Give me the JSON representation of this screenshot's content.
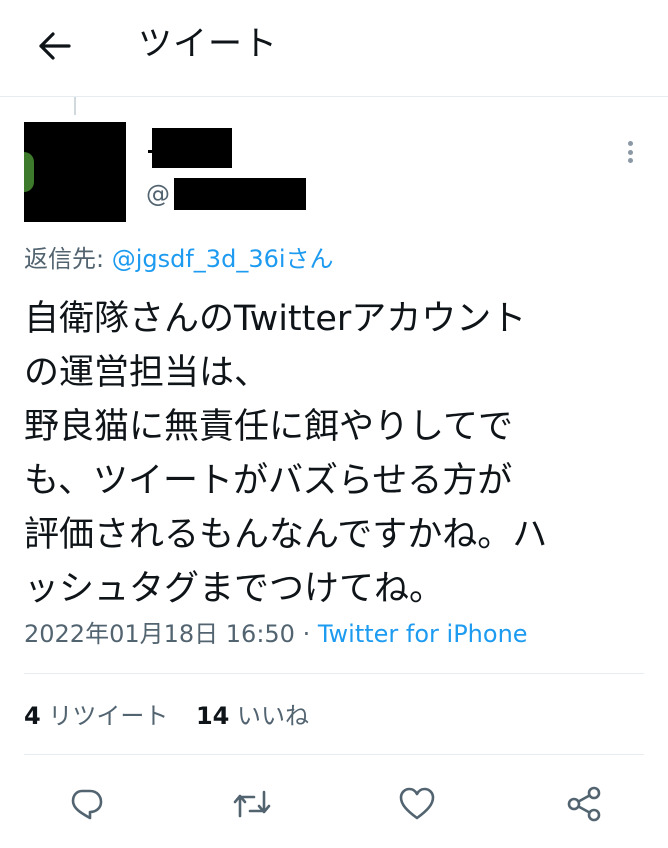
{
  "header": {
    "title": "ツイート"
  },
  "author": {
    "handle_prefix": "@"
  },
  "reply_to": {
    "prefix": "返信先: ",
    "handle": "@jgsdf_3d_36iさん"
  },
  "tweet": {
    "lines": [
      "自衛隊さんのTwitterアカウント",
      "の運営担当は、",
      "野良猫に無責任に餌やりしてで",
      "も、ツイートがバズらせる方が",
      "評価されるもんなんですかね。ハ",
      "ッシュタグまでつけてね。"
    ]
  },
  "meta": {
    "timestamp": "2022年01月18日 16:50",
    "separator": " · ",
    "source": "Twitter for iPhone"
  },
  "stats": {
    "retweets_count": "4",
    "retweets_label": "リツイート",
    "likes_count": "14",
    "likes_label": "いいね"
  },
  "colors": {
    "accent": "#1d9bf0",
    "secondary_text": "#536471",
    "divider": "#e6ecf0"
  }
}
